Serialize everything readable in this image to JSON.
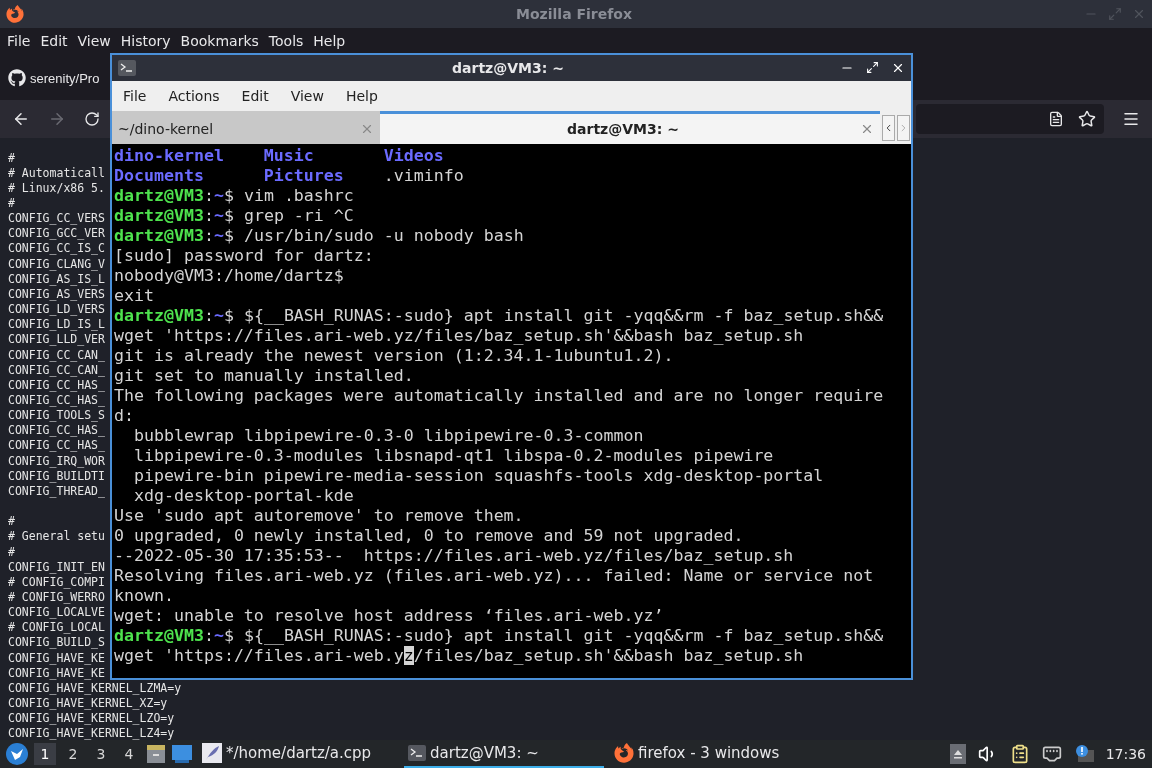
{
  "browser": {
    "title": "Mozilla Firefox",
    "menu": [
      "File",
      "Edit",
      "View",
      "History",
      "Bookmarks",
      "Tools",
      "Help"
    ],
    "tab": {
      "label": "serenity/Pro"
    },
    "editor_blocks": [
      [
        "#",
        "# Automaticall",
        "# Linux/x86 5.",
        "#",
        "CONFIG_CC_VERS",
        "CONFIG_GCC_VER",
        "CONFIG_CC_IS_C",
        "CONFIG_CLANG_V",
        "CONFIG_AS_IS_L",
        "CONFIG_AS_VERS",
        "CONFIG_LD_VERS",
        "CONFIG_LD_IS_L",
        "CONFIG_LLD_VER",
        "CONFIG_CC_CAN_",
        "CONFIG_CC_CAN_",
        "CONFIG_CC_HAS_",
        "CONFIG_CC_HAS_",
        "CONFIG_TOOLS_S",
        "CONFIG_CC_HAS_",
        "CONFIG_CC_HAS_",
        "CONFIG_IRQ_WOR",
        "CONFIG_BUILDTI",
        "CONFIG_THREAD_"
      ],
      [
        "#",
        "# General setu",
        "#",
        "CONFIG_INIT_EN",
        "# CONFIG_COMPI",
        "# CONFIG_WERRO",
        "CONFIG_LOCALVE",
        "# CONFIG_LOCAL",
        "CONFIG_BUILD_S",
        "CONFIG_HAVE_KE",
        "CONFIG_HAVE_KE",
        "CONFIG_HAVE_KERNEL_LZMA=y",
        "CONFIG_HAVE_KERNEL_XZ=y",
        "CONFIG_HAVE_KERNEL_LZO=y",
        "CONFIG_HAVE_KERNEL_LZ4=y"
      ]
    ]
  },
  "terminal": {
    "title": "dartz@VM3: ~",
    "menu": [
      "File",
      "Actions",
      "Edit",
      "View",
      "Help"
    ],
    "tabs": [
      {
        "label": "~/dino-kernel",
        "selected": false
      },
      {
        "label": "dartz@VM3: ~",
        "selected": true
      }
    ],
    "lines": [
      {
        "kind": "listing",
        "items": [
          {
            "text": "dino-kernel",
            "kind": "dir"
          },
          {
            "text": "Music",
            "kind": "dir"
          },
          {
            "text": "Videos",
            "kind": "dir"
          }
        ]
      },
      {
        "kind": "listing",
        "items": [
          {
            "text": "Documents",
            "kind": "dir"
          },
          {
            "text": "Pictures",
            "kind": "dir"
          },
          {
            "text": ".viminfo",
            "kind": "file"
          }
        ]
      },
      {
        "kind": "prompt",
        "user": "dartz@VM3",
        "sep": ":",
        "path": "~",
        "symbol": "$",
        "command": "vim .bashrc"
      },
      {
        "kind": "prompt",
        "user": "dartz@VM3",
        "sep": ":",
        "path": "~",
        "symbol": "$",
        "command": "grep -ri ^C"
      },
      {
        "kind": "prompt",
        "user": "dartz@VM3",
        "sep": ":",
        "path": "~",
        "symbol": "$",
        "command": "/usr/bin/sudo -u nobody bash"
      },
      {
        "kind": "output",
        "text": "[sudo] password for dartz:"
      },
      {
        "kind": "output",
        "text": "nobody@VM3:/home/dartz$"
      },
      {
        "kind": "output",
        "text": "exit"
      },
      {
        "kind": "prompt",
        "user": "dartz@VM3",
        "sep": ":",
        "path": "~",
        "symbol": "$",
        "command": "${__BASH_RUNAS:-sudo} apt install git -yqq&&rm -f baz_setup.sh&&wget 'https://files.ari-web.yz/files/baz_setup.sh'&&bash baz_setup.sh"
      },
      {
        "kind": "output",
        "text": "git is already the newest version (1:2.34.1-1ubuntu1.2)."
      },
      {
        "kind": "output",
        "text": "git set to manually installed."
      },
      {
        "kind": "output",
        "text": "The following packages were automatically installed and are no longer required:"
      },
      {
        "kind": "output",
        "text": "  bubblewrap libpipewire-0.3-0 libpipewire-0.3-common"
      },
      {
        "kind": "output",
        "text": "  libpipewire-0.3-modules libsnapd-qt1 libspa-0.2-modules pipewire"
      },
      {
        "kind": "output",
        "text": "  pipewire-bin pipewire-media-session squashfs-tools xdg-desktop-portal"
      },
      {
        "kind": "output",
        "text": "  xdg-desktop-portal-kde"
      },
      {
        "kind": "output",
        "text": "Use 'sudo apt autoremove' to remove them."
      },
      {
        "kind": "output",
        "text": "0 upgraded, 0 newly installed, 0 to remove and 59 not upgraded."
      },
      {
        "kind": "output",
        "text": "--2022-05-30 17:35:53--  https://files.ari-web.yz/files/baz_setup.sh"
      },
      {
        "kind": "output",
        "text": "Resolving files.ari-web.yz (files.ari-web.yz)... failed: Name or service not known."
      },
      {
        "kind": "output",
        "text": "wget: unable to resolve host address ‘files.ari-web.yz’"
      },
      {
        "kind": "prompt",
        "user": "dartz@VM3",
        "sep": ":",
        "path": "~",
        "symbol": "$",
        "command": "${__BASH_RUNAS:-sudo} apt install git -yqq&&rm -f baz_setup.sh&&wget 'https://files.ari-web.y",
        "cursor": "z",
        "command_after": "/files/baz_setup.sh'&&bash baz_setup.sh"
      }
    ]
  },
  "taskbar": {
    "workspaces": [
      {
        "label": "1",
        "selected": true
      },
      {
        "label": "2",
        "selected": false
      },
      {
        "label": "3",
        "selected": false
      },
      {
        "label": "4",
        "selected": false
      }
    ],
    "tasks": [
      {
        "label": "*/home/dartz/a.cpp",
        "kind": "editor",
        "selected": false
      },
      {
        "label": "dartz@VM3: ~",
        "kind": "terminal",
        "selected": true
      },
      {
        "label": "firefox - 3 windows",
        "kind": "browser",
        "selected": false
      }
    ],
    "clock": "17:36"
  }
}
